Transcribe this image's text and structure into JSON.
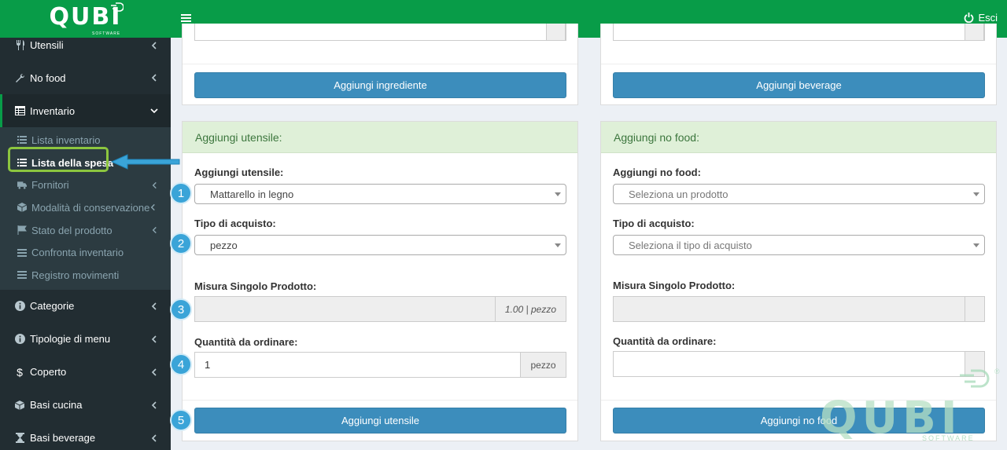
{
  "app": {
    "logo_text": "QUBI",
    "logo_sub": "SOFTWARE",
    "logout_label": "Esci"
  },
  "sidebar": {
    "items": [
      {
        "label": "Utensili",
        "icon": "cutlery-icon"
      },
      {
        "label": "No food",
        "icon": "wrench-icon"
      },
      {
        "label": "Inventario",
        "icon": "table-icon",
        "expanded": true
      }
    ],
    "submenu": [
      {
        "label": "Lista inventario",
        "icon": "list-icon"
      },
      {
        "label": "Lista della spesa",
        "icon": "list-icon",
        "current": true
      },
      {
        "label": "Fornitori",
        "icon": "truck-icon"
      },
      {
        "label": "Modalità di conservazione",
        "icon": "cube-icon"
      },
      {
        "label": "Stato del prodotto",
        "icon": "flag-icon"
      },
      {
        "label": "Confronta inventario",
        "icon": "bars-icon"
      },
      {
        "label": "Registro movimenti",
        "icon": "bars-icon"
      }
    ],
    "items_after": [
      {
        "label": "Categorie",
        "icon": "info-icon"
      },
      {
        "label": "Tipologie di menu",
        "icon": "info-icon"
      },
      {
        "label": "Coperto",
        "icon": "dollar-icon"
      },
      {
        "label": "Basi cucina",
        "icon": "cube-icon"
      },
      {
        "label": "Basi beverage",
        "icon": "hourglass-icon"
      }
    ]
  },
  "top_boxes": {
    "left_button": "Aggiungi ingrediente",
    "right_button": "Aggiungi beverage"
  },
  "utensile": {
    "title": "Aggiungi utensile:",
    "product_label": "Aggiungi utensile:",
    "product_value": "Mattarello in legno",
    "purchase_label": "Tipo di acquisto:",
    "purchase_value": "pezzo",
    "measure_label": "Misura Singolo Prodotto:",
    "measure_value": "",
    "measure_addon": "1.00 | pezzo",
    "qty_label": "Quantità da ordinare:",
    "qty_value": "1",
    "qty_addon": "pezzo",
    "submit": "Aggiungi utensile"
  },
  "nofood": {
    "title": "Aggiungi no food:",
    "product_label": "Aggiungi no food:",
    "product_placeholder": "Seleziona un prodotto",
    "purchase_label": "Tipo di acquisto:",
    "purchase_placeholder": "Seleziona il tipo di acquisto",
    "measure_label": "Misura Singolo Prodotto:",
    "qty_label": "Quantità da ordinare:",
    "submit": "Aggiungi no food"
  },
  "steps": [
    "1",
    "2",
    "3",
    "4",
    "5"
  ],
  "watermark": {
    "text": "QUBI",
    "sub": "SOFTWARE"
  },
  "colors": {
    "brand_green": "#089c48",
    "primary": "#3c8dbc",
    "sidebar": "#222d32",
    "callout": "#3aa4d8",
    "highlight": "#8cc63f"
  }
}
